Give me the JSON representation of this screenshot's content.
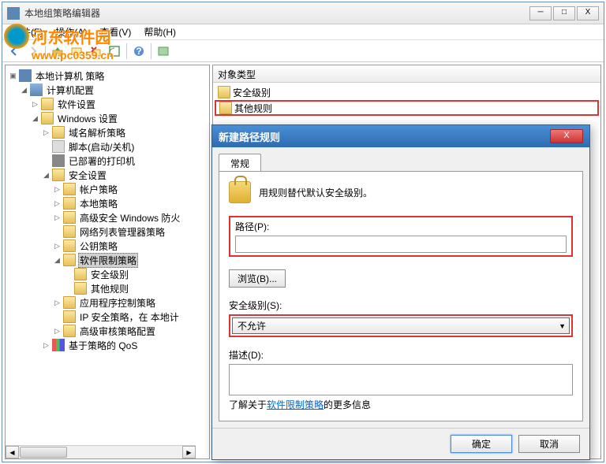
{
  "watermark": {
    "text": "河东软件园",
    "url": "www.pc0359.cn"
  },
  "window": {
    "title": "本地组策略编辑器",
    "btn_min": "─",
    "btn_max": "□",
    "btn_close": "X"
  },
  "menu": {
    "file": "文件(F)",
    "action": "操作(A)",
    "view": "查看(V)",
    "help": "帮助(H)"
  },
  "tree": {
    "root": "本地计算机 策略",
    "computer_config": "计算机配置",
    "software_settings": "软件设置",
    "windows_settings": "Windows 设置",
    "dns_policy": "域名解析策略",
    "scripts": "脚本(启动/关机)",
    "deployed_printers": "已部署的打印机",
    "security_settings": "安全设置",
    "account_policy": "帐户策略",
    "local_policy": "本地策略",
    "windows_firewall": "高级安全 Windows 防火",
    "network_list": "网络列表管理器策略",
    "public_key": "公钥策略",
    "software_restriction": "软件限制策略",
    "security_level": "安全级别",
    "other_rules": "其他规则",
    "app_control": "应用程序控制策略",
    "ip_security": "IP 安全策略，在 本地计",
    "advanced_audit": "高级审核策略配置",
    "qos": "基于策略的 QoS"
  },
  "list": {
    "header": "对象类型",
    "item1": "安全级别",
    "item2": "其他规则"
  },
  "dialog": {
    "title": "新建路径规则",
    "close_x": "X",
    "tab_general": "常规",
    "instruction": "用规则替代默认安全级别。",
    "path_label": "路径(P):",
    "browse_btn": "浏览(B)...",
    "security_label": "安全级别(S):",
    "security_value": "不允许",
    "description_label": "描述(D):",
    "learn_prefix": "了解关于",
    "learn_link": "软件限制策略",
    "learn_suffix": "的更多信息",
    "ok_btn": "确定",
    "cancel_btn": "取消"
  }
}
